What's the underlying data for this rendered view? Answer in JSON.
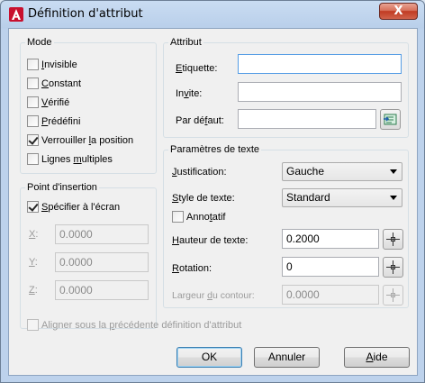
{
  "window": {
    "title": "Définition d'attribut",
    "close_label": "X"
  },
  "mode": {
    "title": "Mode",
    "options": [
      {
        "key": "I",
        "rest": "nvisible",
        "pre": "",
        "checked": false
      },
      {
        "key": "C",
        "rest": "onstant",
        "pre": "",
        "checked": false
      },
      {
        "key": "V",
        "rest": "érifié",
        "pre": "",
        "checked": false
      },
      {
        "key": "P",
        "rest": "rédéfini",
        "pre": "",
        "checked": false
      },
      {
        "key": "l",
        "rest": "a position",
        "pre": "Verrouiller ",
        "checked": true
      },
      {
        "key": "m",
        "rest": "ultiples",
        "pre": "Lignes ",
        "checked": false
      }
    ]
  },
  "insertion": {
    "title": "Point d'insertion",
    "specify": {
      "key": "S",
      "rest": "pécifier à l'écran",
      "checked": true
    },
    "x": {
      "key": "X",
      "rest": ":",
      "value": "0.0000"
    },
    "y": {
      "key": "Y",
      "rest": ":",
      "value": "0.0000"
    },
    "z": {
      "key": "Z",
      "rest": ":",
      "value": "0.0000"
    }
  },
  "attribut": {
    "title": "Attribut",
    "etiquette": {
      "key": "E",
      "rest": "tiquette:",
      "value": ""
    },
    "invite": {
      "key": "v",
      "pre": "In",
      "rest": "ite:",
      "value": ""
    },
    "defaut": {
      "key": "f",
      "pre": "Par dé",
      "rest": "aut:",
      "value": ""
    }
  },
  "texte": {
    "title": "Paramètres de texte",
    "justification": {
      "key": "J",
      "rest": "ustification:",
      "value": "Gauche"
    },
    "style": {
      "key": "S",
      "rest": "tyle de texte:",
      "value": "Standard"
    },
    "annotatif": {
      "pre": "Anno",
      "key": "t",
      "rest": "atif",
      "checked": false
    },
    "hauteur": {
      "key": "H",
      "rest": "auteur de texte:",
      "value": "0.2000"
    },
    "rotation": {
      "key": "R",
      "rest": "otation:",
      "value": "0"
    },
    "largeur": {
      "pre": "Largeur ",
      "key": "d",
      "rest": "u contour:",
      "value": "0.0000"
    }
  },
  "align": {
    "pre": "Aligner sous la ",
    "key": "p",
    "rest": "récédente définition d'attribut",
    "checked": false
  },
  "buttons": {
    "ok": "OK",
    "annuler": "Annuler",
    "aide_key": "A",
    "aide_rest": "ide"
  }
}
